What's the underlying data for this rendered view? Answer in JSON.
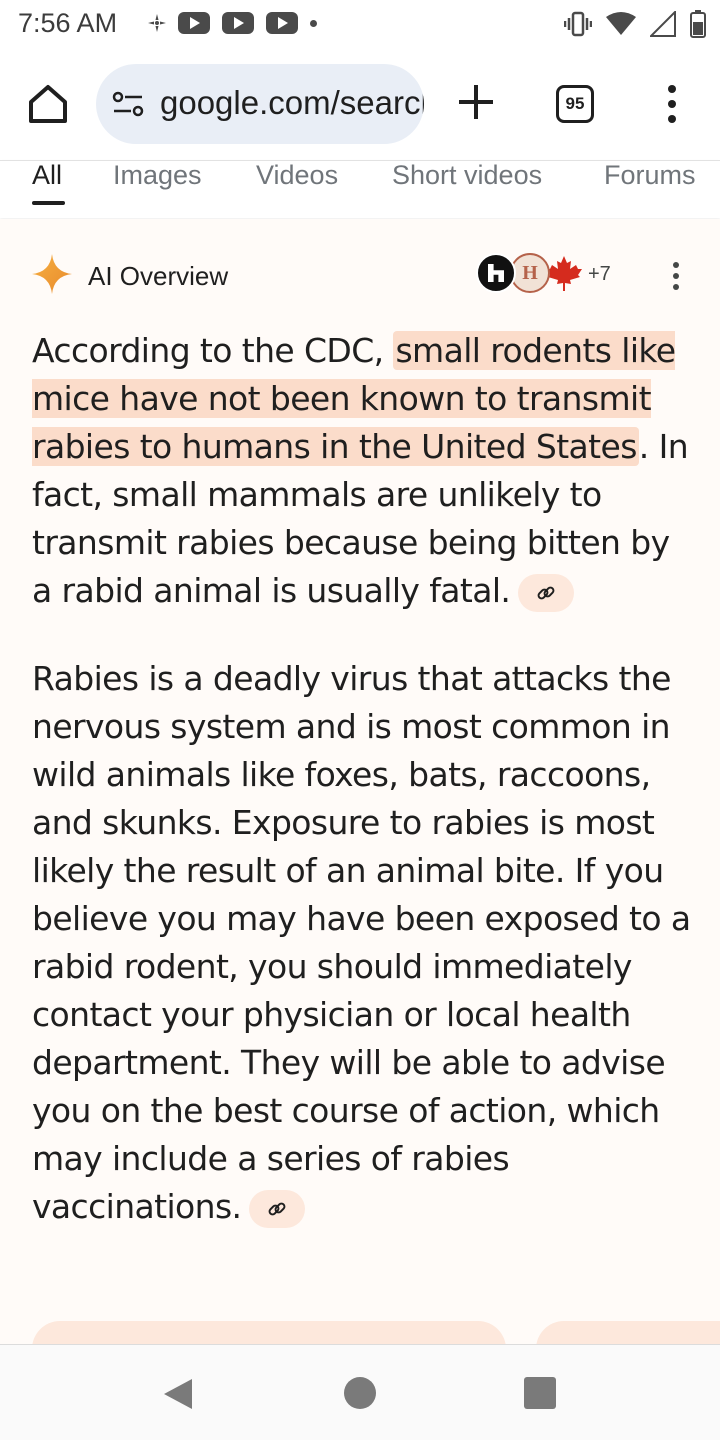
{
  "status_bar": {
    "time": "7:56 AM",
    "notification_icons": [
      "fan-icon",
      "youtube-icon",
      "youtube-icon",
      "youtube-icon",
      "dot-icon"
    ],
    "system_icons": [
      "vibrate-icon",
      "wifi-icon",
      "signal-icon",
      "battery-icon"
    ]
  },
  "toolbar": {
    "url": "google.com/search",
    "tab_count": "95"
  },
  "filter_tabs": [
    {
      "label": "All",
      "active": true
    },
    {
      "label": "Images",
      "active": false
    },
    {
      "label": "Videos",
      "active": false
    },
    {
      "label": "Short videos",
      "active": false
    },
    {
      "label": "Forums",
      "active": false
    }
  ],
  "ai_overview": {
    "title": "AI Overview",
    "source_count": "+7",
    "source_icons": [
      "h-logo-icon",
      "h-crest-icon",
      "maple-leaf-icon"
    ],
    "paragraph1": {
      "before": "According to the CDC, ",
      "highlight": "small rodents like mice have not been known to transmit rabies to humans in the United States",
      "after": ". In fact, small mammals are unlikely to transmit rabies because being bitten by a rabid animal is usually fatal."
    },
    "paragraph2": "Rabies is a deadly virus that attacks the nervous system and is most common in wild animals like foxes, bats, raccoons, and skunks. Exposure to rabies is most likely the result of an animal bite. If you believe you may have been exposed to a rabid rodent, you should immediately contact your physician or local health department. They will be able to advise you on the best course of action, which may include a series of rabies vaccinations."
  },
  "colors": {
    "highlight": "#fbdcca",
    "content_bg": "#fffbf8",
    "url_bar_bg": "#e9eef6",
    "text": "#1f1f1f",
    "tab_inactive": "#70757a"
  }
}
